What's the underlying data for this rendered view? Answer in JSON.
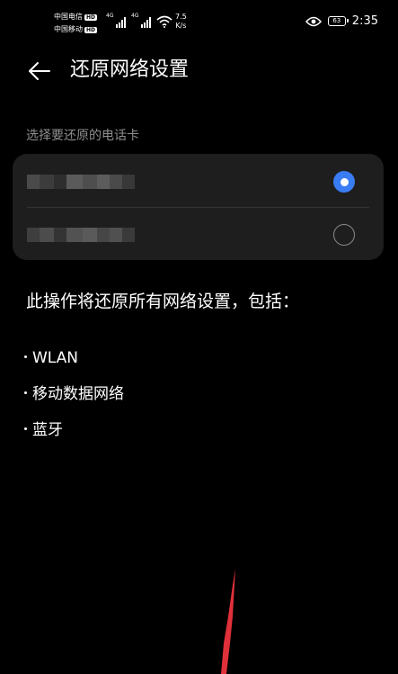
{
  "status_bar": {
    "carrier_1": "中国电信",
    "carrier_2": "中国移动",
    "hd_label": "HD",
    "network_1": "4G",
    "network_2": "4G",
    "net_speed_value": "7.5",
    "net_speed_unit": "K/s",
    "battery_level": "63",
    "time": "2:35"
  },
  "header": {
    "title": "还原网络设置"
  },
  "sim_section": {
    "label": "选择要还原的电话卡",
    "cards": [
      {
        "selected": true
      },
      {
        "selected": false
      }
    ]
  },
  "description": {
    "text": "此操作将还原所有网络设置，包括：",
    "items": [
      "WLAN",
      "移动数据网络",
      "蓝牙"
    ]
  },
  "colors": {
    "background": "#000000",
    "card_background": "#1e1e1e",
    "accent": "#3a7cf4",
    "secondary_text": "#8e8e8e",
    "streak": "#e0303a"
  }
}
